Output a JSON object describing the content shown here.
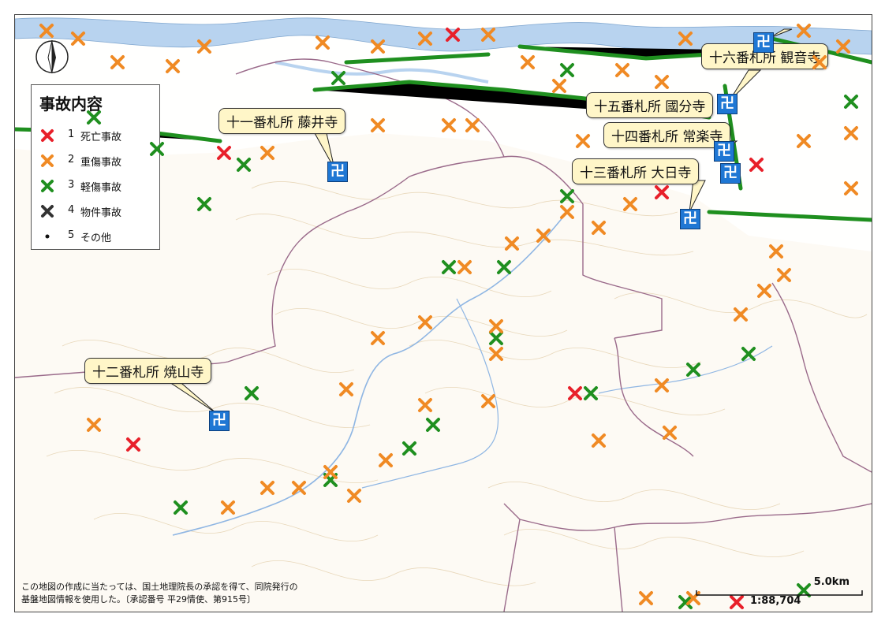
{
  "legend": {
    "title": "事故内容",
    "items": [
      {
        "num": "1",
        "label": "死亡事故",
        "color": "#e8202a"
      },
      {
        "num": "2",
        "label": "重傷事故",
        "color": "#f08a24"
      },
      {
        "num": "3",
        "label": "軽傷事故",
        "color": "#1f8f1f"
      },
      {
        "num": "4",
        "label": "物件事故",
        "color": "#333333"
      },
      {
        "num": "5",
        "label": "その他",
        "color": "#111111"
      }
    ]
  },
  "temples": [
    {
      "label": "十一番札所 藤井寺"
    },
    {
      "label": "十二番札所 焼山寺"
    },
    {
      "label": "十三番札所 大日寺"
    },
    {
      "label": "十四番札所 常楽寺"
    },
    {
      "label": "十五番札所 國分寺"
    },
    {
      "label": "十六番札所 観音寺"
    }
  ],
  "credit": {
    "line1": "この地図の作成に当たっては、国土地理院長の承認を得て、同院発行の",
    "line2": "基盤地図情報を使用した。〔承認番号 平29情使、第915号〕"
  },
  "scale": {
    "distance": "5.0km",
    "ratio": "1:88,704"
  },
  "colors": {
    "river": "#b8d3ef",
    "contour": "#e2cfae",
    "boundary": "#9a6a8a",
    "temple": "#1f77d4",
    "callout": "#fff6c8"
  }
}
